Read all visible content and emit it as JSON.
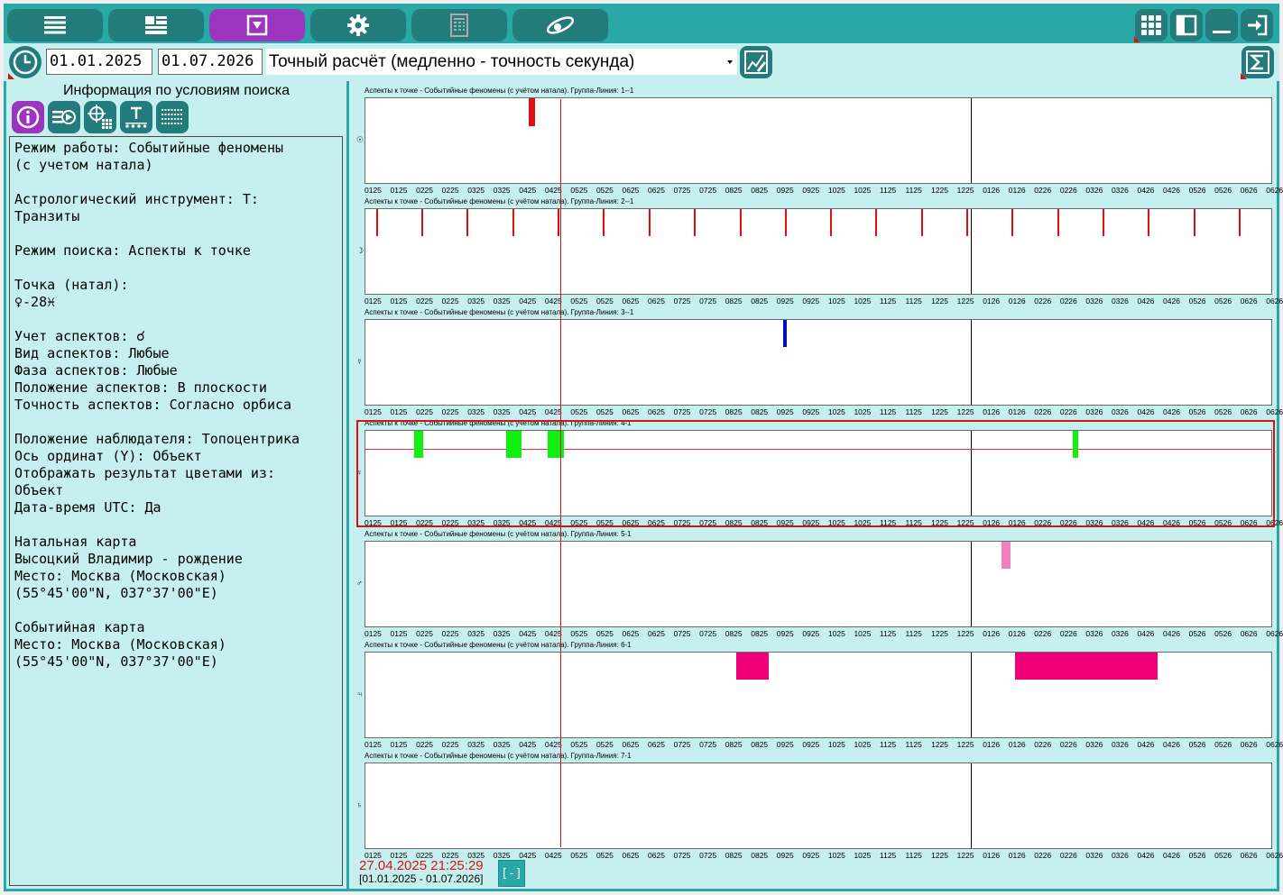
{
  "toolbar": {
    "buttons": [
      "list-icon",
      "layout-icon",
      "filter-icon",
      "gear-icon",
      "spreadsheet-icon",
      "orbit-logo-icon"
    ],
    "active_index": 2,
    "right_buttons": [
      "grid-icon",
      "panel-icon",
      "minimize-icon",
      "exit-icon"
    ]
  },
  "search_bar": {
    "date_from": "01.01.2025",
    "date_to": "01.07.2026",
    "mode": "Точный расчёт (медленно - точность секунда)"
  },
  "left_panel": {
    "title": "Информация по условиям поиска",
    "buttons": [
      "info-icon",
      "export-icon",
      "target-grid-icon",
      "text-ticks-icon",
      "stripes-icon"
    ],
    "info_lines": [
      "Режим работы: Событийные феномены",
      "(с учетом натала)",
      "",
      "Астрологический инструмент: T:",
      "Транзиты",
      "",
      "Режим поиска: Аспекты к точке",
      "",
      "Точка (натал):",
      "♀-28♓",
      "",
      "Учет аспектов: ☌",
      "Вид аспектов: Любые",
      "Фаза аспектов: Любые",
      "Положение аспектов: В плоскости",
      "Точность аспектов: Согласно орбиса",
      "",
      "Положение наблюдателя: Топоцентрика",
      "Ось ординат (Y): Объект",
      "Отображать результат цветами из:",
      "Объект",
      "Дата-время UTC: Да",
      "",
      "Натальная карта",
      "Высоцкий Владимир - рождение",
      "Место: Москва (Московская)",
      "(55°45'00\"N, 037°37'00\"E)",
      "",
      "Событийная карта",
      "Место: Москва (Московская)",
      "(55°45'00\"N, 037°37'00\"E)"
    ]
  },
  "charts": {
    "tick_labels": [
      "0125",
      "0125",
      "0225",
      "0225",
      "0325",
      "0325",
      "0425",
      "0425",
      "0525",
      "0525",
      "0625",
      "0625",
      "0725",
      "0725",
      "0825",
      "0825",
      "0925",
      "0925",
      "1025",
      "1025",
      "1125",
      "1125",
      "1225",
      "1225",
      "0126",
      "0126",
      "0226",
      "0226",
      "0326",
      "0326",
      "0426",
      "0426",
      "0526",
      "0526",
      "0626",
      "0626"
    ],
    "rows": [
      {
        "title": "Аспекты к точке - Событийные феномены (с учётом натала). Группа-Линия: 1--1",
        "planet": "☉",
        "color": "#e01010"
      },
      {
        "title": "Аспекты к точке - Событийные феномены (с учётом натала). Группа-Линия: 2--1",
        "planet": "☽",
        "color": "#e01010"
      },
      {
        "title": "Аспекты к точке - Событийные феномены (с учётом натала). Группа-Линия: 3--1",
        "planet": "☿",
        "color": "#0010c0"
      },
      {
        "title": "Аспекты к точке - Событийные феномены (с учётом натала). Группа-Линия: 4-1",
        "planet": "♀",
        "color": "#10f010"
      },
      {
        "title": "Аспекты к точке - Событийные феномены (с учётом натала). Группа-Линия: 5-1",
        "planet": "♂",
        "color": "#f080c0"
      },
      {
        "title": "Аспекты к точке - Событийные феномены (с учётом натала). Группа-Линия: 6-1",
        "planet": "♃",
        "color": "#f00078"
      },
      {
        "title": "Аспекты к точке - Событийные феномены (с учётом натала). Группа-Линия: 7-1",
        "planet": "♄",
        "color": "#000000"
      }
    ]
  },
  "status": {
    "current_datetime": "27.04.2025 21:25:29",
    "range": "[01.01.2025 - 01.07.2026]",
    "collapse_label": "[-]"
  }
}
